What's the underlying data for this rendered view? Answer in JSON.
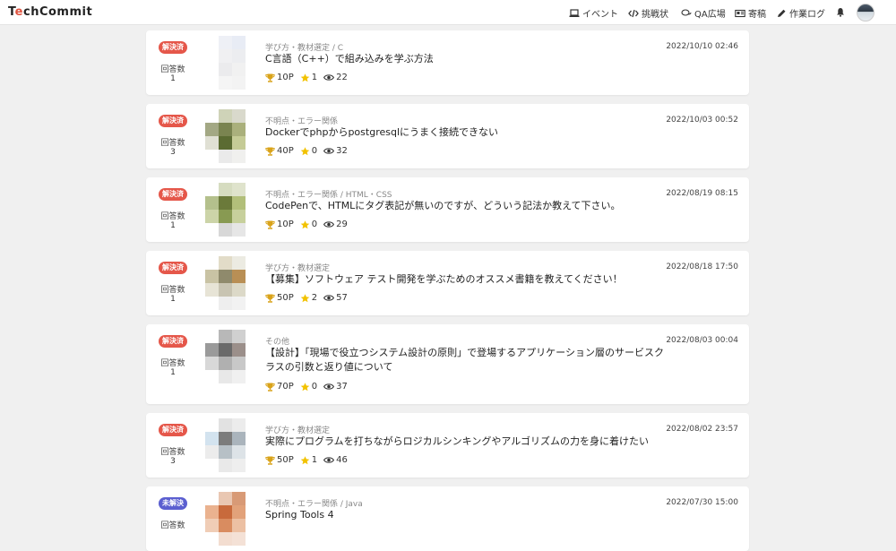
{
  "header": {
    "logo_pre": "T",
    "logo_e": "e",
    "logo_post": "chCommit",
    "nav": [
      {
        "label": "イベント",
        "icon": "laptop-icon"
      },
      {
        "label": "挑戦状",
        "icon": "code-icon"
      },
      {
        "label": "QA広場",
        "icon": "chat-icon"
      },
      {
        "label": "寄稿",
        "icon": "newspaper-icon"
      },
      {
        "label": "作業ログ",
        "icon": "pencil-icon"
      }
    ],
    "bell_icon": "bell-icon",
    "avatar_icon": "user-avatar"
  },
  "labels": {
    "answers": "回答数"
  },
  "questions": [
    {
      "status": "解決済",
      "status_type": "solved",
      "answers": "1",
      "category": "学び方・教材選定 / C",
      "title": "C言語（C++）で組み込みを学ぶ方法",
      "points": "10P",
      "stars": "1",
      "views": "22",
      "date": "2022/10/10 02:46",
      "thumb": [
        "#fff",
        "#eef0f6",
        "#e8ecf5",
        "#fff",
        "#fff",
        "#f0f0f2",
        "#ecedf0",
        "#fff",
        "#fff",
        "#ebebed",
        "#f1f1f1",
        "#fff",
        "#fff",
        "#f5f5f5",
        "#f3f3f3",
        "#fff"
      ]
    },
    {
      "status": "解決済",
      "status_type": "solved",
      "answers": "3",
      "category": "不明点・エラー関係",
      "title": "Dockerでphpからpostgresqlにうまく接続できない",
      "points": "40P",
      "stars": "0",
      "views": "32",
      "date": "2022/10/03 00:52",
      "thumb": [
        "#fff",
        "#cfd3b8",
        "#d9d9cc",
        "#fff",
        "#a3a884",
        "#7a8450",
        "#aab07c",
        "#fff",
        "#e0e0d4",
        "#5b6b32",
        "#c5cb96",
        "#fff",
        "#fff",
        "#eaeaea",
        "#f0f0ee",
        "#fff"
      ]
    },
    {
      "status": "解決済",
      "status_type": "solved",
      "answers": "1",
      "category": "不明点・エラー関係 / HTML・CSS",
      "title": "CodePenで、HTMLにタグ表記が無いのですが、どういう記法か教えて下さい。",
      "points": "10P",
      "stars": "0",
      "views": "29",
      "date": "2022/08/19 08:15",
      "thumb": [
        "#fff",
        "#d6dcc0",
        "#dfe3cc",
        "#fff",
        "#b4c08c",
        "#6b7a3a",
        "#b2bf7a",
        "#fff",
        "#ccd4a8",
        "#889a52",
        "#c7d09c",
        "#fff",
        "#fff",
        "#d8d8d8",
        "#e6e6e6",
        "#fff"
      ]
    },
    {
      "status": "解決済",
      "status_type": "solved",
      "answers": "1",
      "category": "学び方・教材選定",
      "title": "【募集】ソフトウェア テスト開発を学ぶためのオススメ書籍を教えてください！",
      "points": "50P",
      "stars": "2",
      "views": "57",
      "date": "2022/08/18 17:50",
      "thumb": [
        "#fff",
        "#e2dcc8",
        "#ecebe2",
        "#fff",
        "#c9c3a4",
        "#8f8a6c",
        "#b98f55",
        "#fff",
        "#e7e4d6",
        "#c8c4b2",
        "#dcd9c8",
        "#fff",
        "#fff",
        "#eeeeee",
        "#f2f2f2",
        "#fff"
      ]
    },
    {
      "status": "解決済",
      "status_type": "solved",
      "answers": "1",
      "category": "その他",
      "title": "【設計】「現場で役立つシステム設計の原則」で登場するアプリケーション層のサービスクラスの引数と返り値について",
      "points": "70P",
      "stars": "0",
      "views": "37",
      "date": "2022/08/03 00:04",
      "thumb": [
        "#fff",
        "#b8b8b8",
        "#d0d0d0",
        "#fff",
        "#9a9a9a",
        "#6a6a6a",
        "#9b8f8a",
        "#fff",
        "#d8d8d8",
        "#b0b0b0",
        "#c8c8c8",
        "#fff",
        "#fff",
        "#e8e8e8",
        "#f0f0f0",
        "#fff"
      ]
    },
    {
      "status": "解決済",
      "status_type": "solved",
      "answers": "3",
      "category": "学び方・教材選定",
      "title": "実際にプログラムを打ちながらロジカルシンキングやアルゴリズムの力を身に着けたい",
      "points": "50P",
      "stars": "1",
      "views": "46",
      "date": "2022/08/02 23:57",
      "thumb": [
        "#fff",
        "#e2e2e2",
        "#ececec",
        "#fff",
        "#d3e3ef",
        "#7c7c7c",
        "#aab4bc",
        "#fff",
        "#ececec",
        "#b7c0c6",
        "#dde3e7",
        "#fff",
        "#fff",
        "#e9e9e9",
        "#eeeeee",
        "#fff"
      ]
    },
    {
      "status": "未解決",
      "status_type": "unsolved",
      "answers": "",
      "category": "不明点・エラー関係 / Java",
      "title": "Spring Tools 4",
      "points": "",
      "stars": "",
      "views": "",
      "date": "2022/07/30 15:00",
      "thumb": [
        "#fff",
        "#e9c7b2",
        "#d89a76",
        "#fff",
        "#eab28f",
        "#c86a3c",
        "#e2a27a",
        "#fff",
        "#f0cdb6",
        "#d98c60",
        "#ecc0a3",
        "#fff",
        "#fff",
        "#f3ddd0",
        "#f4e1d6",
        "#fff"
      ]
    }
  ]
}
